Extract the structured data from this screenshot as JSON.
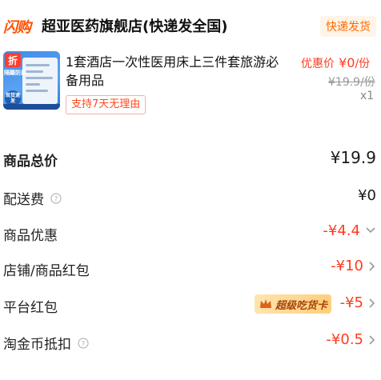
{
  "header": {
    "flash_logo": "闪购",
    "shop_name": "超亚医药旗舰店(快递发全国)",
    "ship_tag": "快递发货"
  },
  "product": {
    "title": "1套酒店一次性医用床上三件套旅游必备用品",
    "promise_tag": "支持7天无理由",
    "promo_label": "优惠价",
    "promo_price": "¥0",
    "promo_unit": "/份",
    "original_price": "¥19.9/份",
    "quantity": "x1",
    "thumb": {
      "badge": "折",
      "label": "隔離防菌",
      "circle": "现货速发"
    }
  },
  "summary": {
    "total_label": "商品总价",
    "total_value": "¥19.9",
    "shipping_label": "配送费",
    "shipping_value": "¥0",
    "discount_label": "商品优惠",
    "discount_value": "-¥4.4",
    "shop_coupon_label": "店铺/商品红包",
    "shop_coupon_value": "-¥10",
    "platform_coupon_label": "平台红包",
    "platform_coupon_badge": "超级吃货卡",
    "platform_coupon_value": "-¥5",
    "taojinbi_label": "淘金币抵扣",
    "taojinbi_value": "-¥0.5"
  },
  "colors": {
    "accent": "#ff3b1f",
    "brand_orange": "#ff5000"
  },
  "icons": [
    "help-icon",
    "chevron-right-icon",
    "chevron-down-icon",
    "crown-icon"
  ]
}
